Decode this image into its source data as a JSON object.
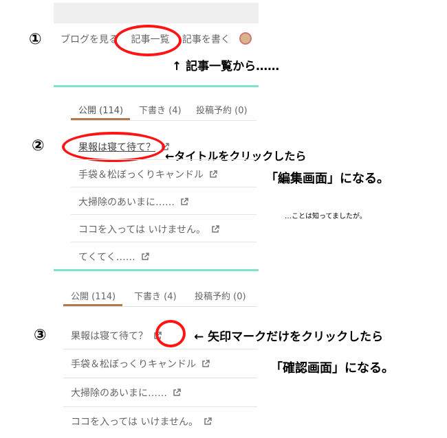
{
  "panel1": {
    "step": "①",
    "nav_items": [
      "ブログを見る",
      "記事一覧",
      "記事を書く"
    ],
    "note": "↑ 記事一覧から……"
  },
  "panel2": {
    "step": "②",
    "tabs": [
      "公開 (114)",
      "下書き (4)",
      "投稿予約 (0)"
    ],
    "rows": [
      "果報は寝て待て？",
      "手袋＆松ぼっくりキャンドル",
      "大掃除のあいまに……",
      "ココを入っては いけません。",
      "てくてく……"
    ],
    "note_pointer": "←タイトルをクリックしたら",
    "note_result": "「編集画面」になる。",
    "note_small": "…ことは知ってましたが。"
  },
  "panel3": {
    "step": "③",
    "tabs": [
      "公開 (114)",
      "下書き (4)",
      "投稿予約 (0)"
    ],
    "rows": [
      "果報は寝て待て？",
      "手袋＆松ぼっくりキャンドル",
      "大掃除のあいまに……",
      "ココを入っては いけません。"
    ],
    "note_pointer": "← 矢印マークだけをクリックしたら",
    "note_result": "「確認画面」になる。"
  },
  "colors": {
    "highlight": "#ff1414",
    "divider": "#80e3cf",
    "tab_active": "#b07a4f"
  },
  "icons": {
    "external_link": "external-link-icon"
  }
}
